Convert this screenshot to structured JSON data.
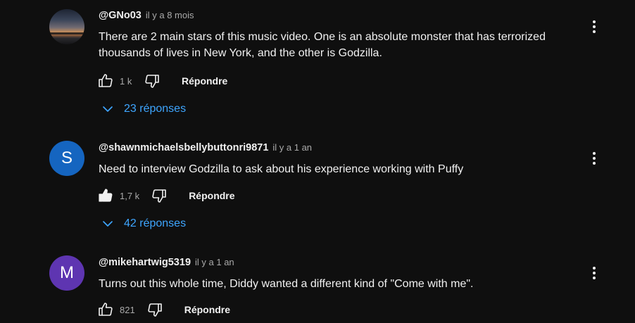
{
  "comments": [
    {
      "author": "@GNo03",
      "time": "il y a 8 mois",
      "text": "There are 2 main stars of this music video. One is an absolute monster that has terrorized thousands of lives in New York, and the other is Godzilla.",
      "likes": "1 k",
      "reply_label": "Répondre",
      "replies_label": "23 réponses",
      "avatar_letter": "",
      "avatar_color": "",
      "liked": false
    },
    {
      "author": "@shawnmichaelsbellybuttonri9871",
      "time": "il y a 1 an",
      "text": "Need to interview Godzilla to ask about his experience working with Puffy",
      "likes": "1,7 k",
      "reply_label": "Répondre",
      "replies_label": "42 réponses",
      "avatar_letter": "S",
      "avatar_color": "#1565c0",
      "liked": true
    },
    {
      "author": "@mikehartwig5319",
      "time": "il y a 1 an",
      "text": "Turns out this whole time, Diddy wanted a different kind of \"Come with me\".",
      "likes": "821",
      "reply_label": "Répondre",
      "avatar_letter": "M",
      "avatar_color": "#5e35b1",
      "liked": false
    }
  ],
  "colors": {
    "background": "#0f0f0f",
    "primary_text": "#f1f1f1",
    "secondary_text": "#aaaaaa",
    "link": "#3ea6ff"
  },
  "icons": [
    "like-icon",
    "like-filled-icon",
    "dislike-icon",
    "chevron-down-icon",
    "more-vert-icon"
  ]
}
